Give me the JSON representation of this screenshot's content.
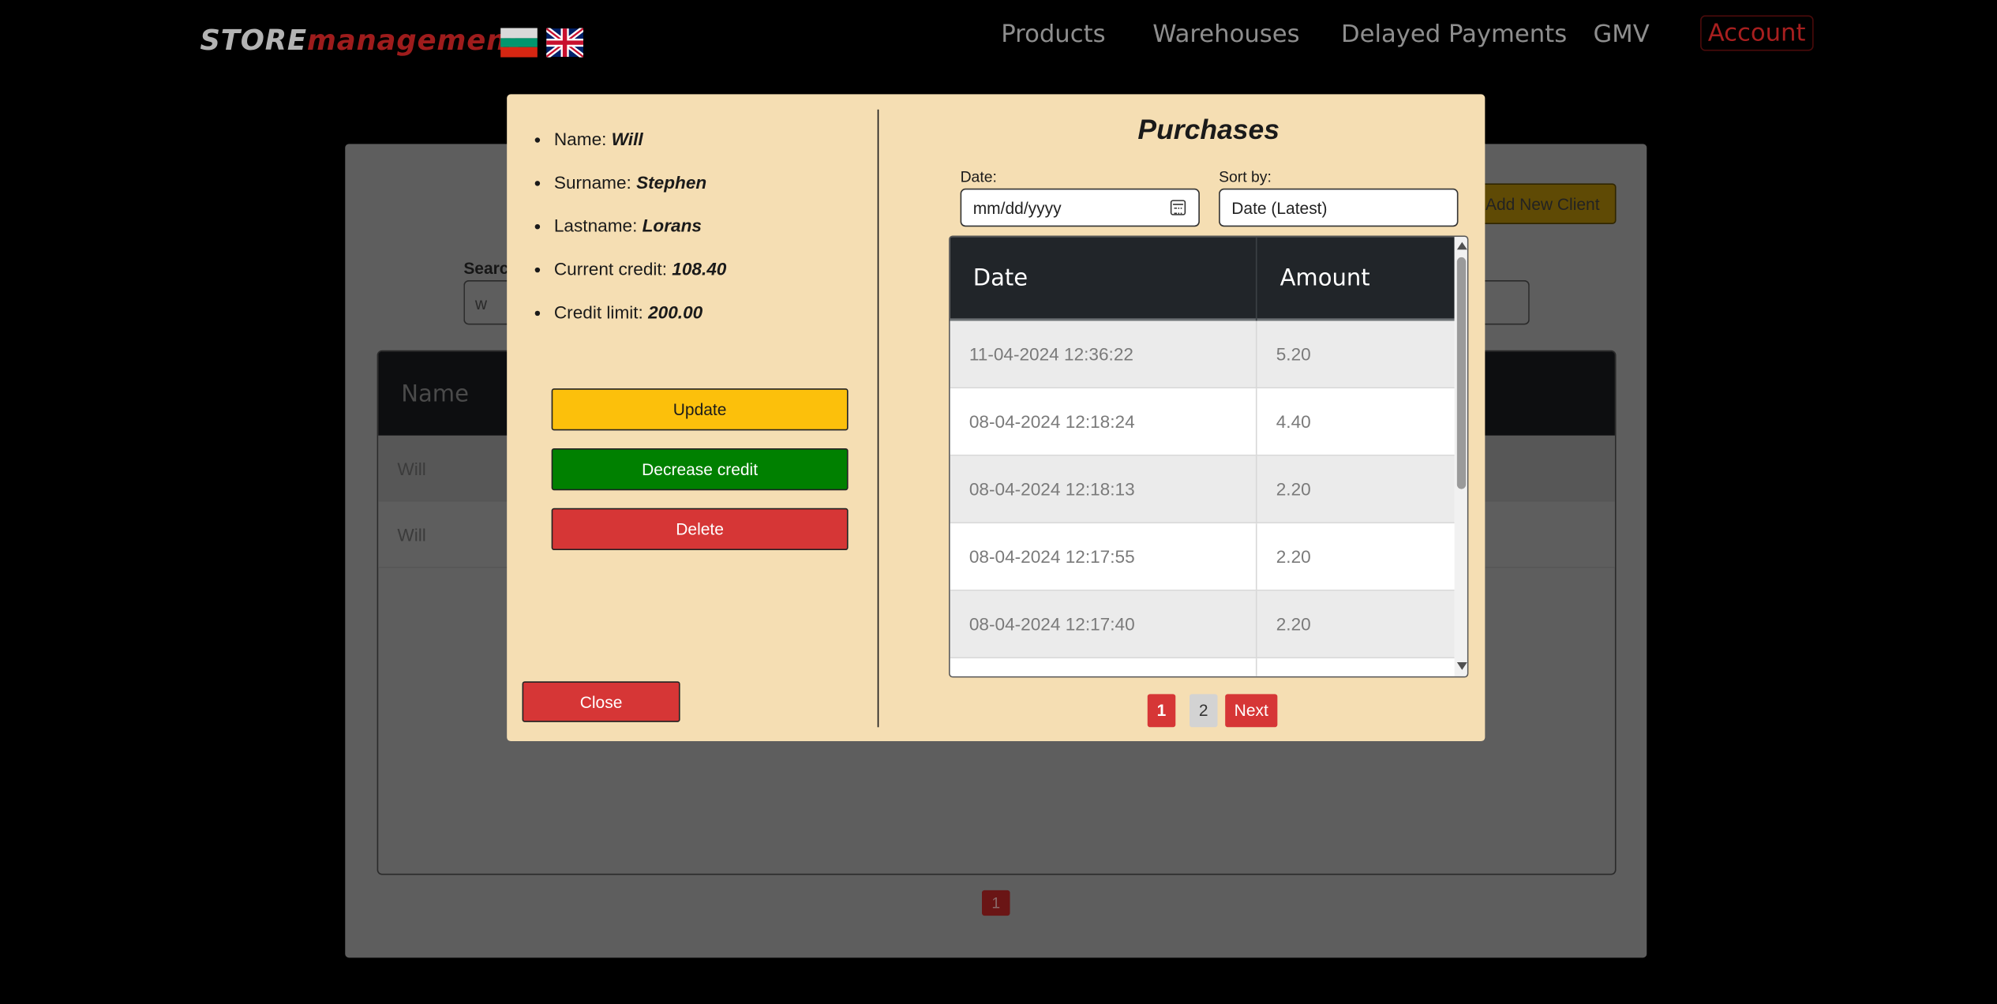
{
  "nav": {
    "brand_store": "STORE",
    "brand_management": "management",
    "flags": [
      "bulgarian-flag",
      "uk-flag"
    ],
    "links": [
      "Products",
      "Warehouses",
      "Delayed Payments",
      "GMV"
    ],
    "account": "Account"
  },
  "background": {
    "search_label": "Search",
    "search_value": "w",
    "add_button": "Add New Client",
    "table_header_name": "Name",
    "rows": [
      "Will",
      "Will"
    ],
    "page": "1"
  },
  "modal": {
    "info": [
      {
        "label": "Name: ",
        "value": "Will"
      },
      {
        "label": "Surname: ",
        "value": "Stephen"
      },
      {
        "label": "Lastname: ",
        "value": "Lorans"
      },
      {
        "label": "Current credit: ",
        "value": "108.40"
      },
      {
        "label": "Credit limit: ",
        "value": "200.00"
      }
    ],
    "buttons": {
      "update": "Update",
      "decrease": "Decrease credit",
      "delete": "Delete",
      "close": "Close"
    },
    "purchases": {
      "title": "Purchases",
      "date_label": "Date:",
      "date_placeholder": "mm/dd/yyyy",
      "sort_label": "Sort by:",
      "sort_value": "Date (Latest)",
      "columns": [
        "Date",
        "Amount"
      ],
      "rows": [
        {
          "date": "11-04-2024 12:36:22",
          "amount": "5.20"
        },
        {
          "date": "08-04-2024 12:18:24",
          "amount": "4.40"
        },
        {
          "date": "08-04-2024 12:18:13",
          "amount": "2.20"
        },
        {
          "date": "08-04-2024 12:17:55",
          "amount": "2.20"
        },
        {
          "date": "08-04-2024 12:17:40",
          "amount": "2.20"
        }
      ],
      "pagination": {
        "current": "1",
        "other": "2",
        "next": "Next"
      }
    }
  },
  "colors": {
    "modal_bg": "#f5deb3",
    "update": "#fcc00b",
    "decrease": "#008000",
    "delete": "#d63636",
    "table_header": "#212529"
  }
}
